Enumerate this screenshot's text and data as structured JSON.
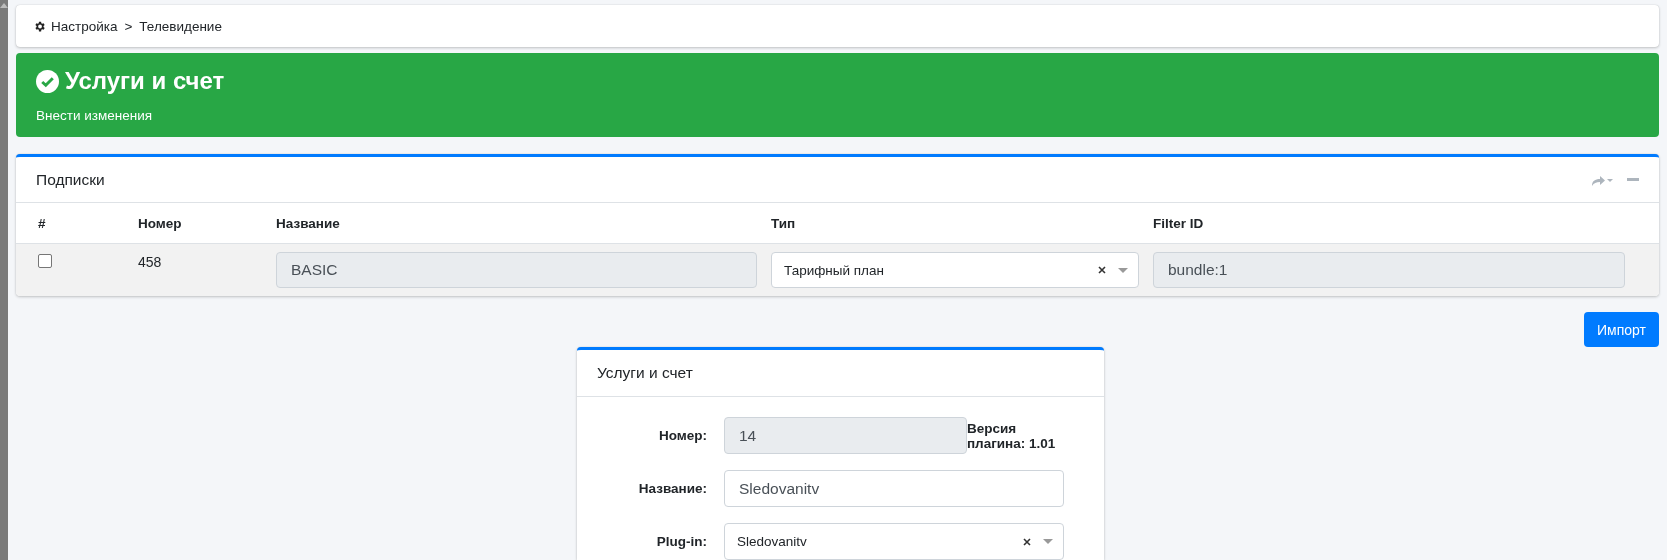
{
  "breadcrumb": {
    "items": [
      "Настройка",
      "Телевидение"
    ],
    "separator": ">"
  },
  "header": {
    "title": "Услуги и счет",
    "subtitle": "Внести изменения"
  },
  "subscriptions": {
    "title": "Подписки",
    "columns": [
      "#",
      "Номер",
      "Название",
      "Тип",
      "Filter ID"
    ],
    "rows": [
      {
        "checked": false,
        "number": "458",
        "name": "BASIC",
        "type": "Тарифный план",
        "filter_id": "bundle:1"
      }
    ]
  },
  "import_button": "Импорт",
  "service_card": {
    "title": "Услуги и счет",
    "number_label": "Номер:",
    "number": "14",
    "version": "Версия плагина: 1.01",
    "name_label": "Название:",
    "name": "Sledovanitv",
    "plugin_label": "Plug-in:",
    "plugin": "Sledovanitv"
  }
}
